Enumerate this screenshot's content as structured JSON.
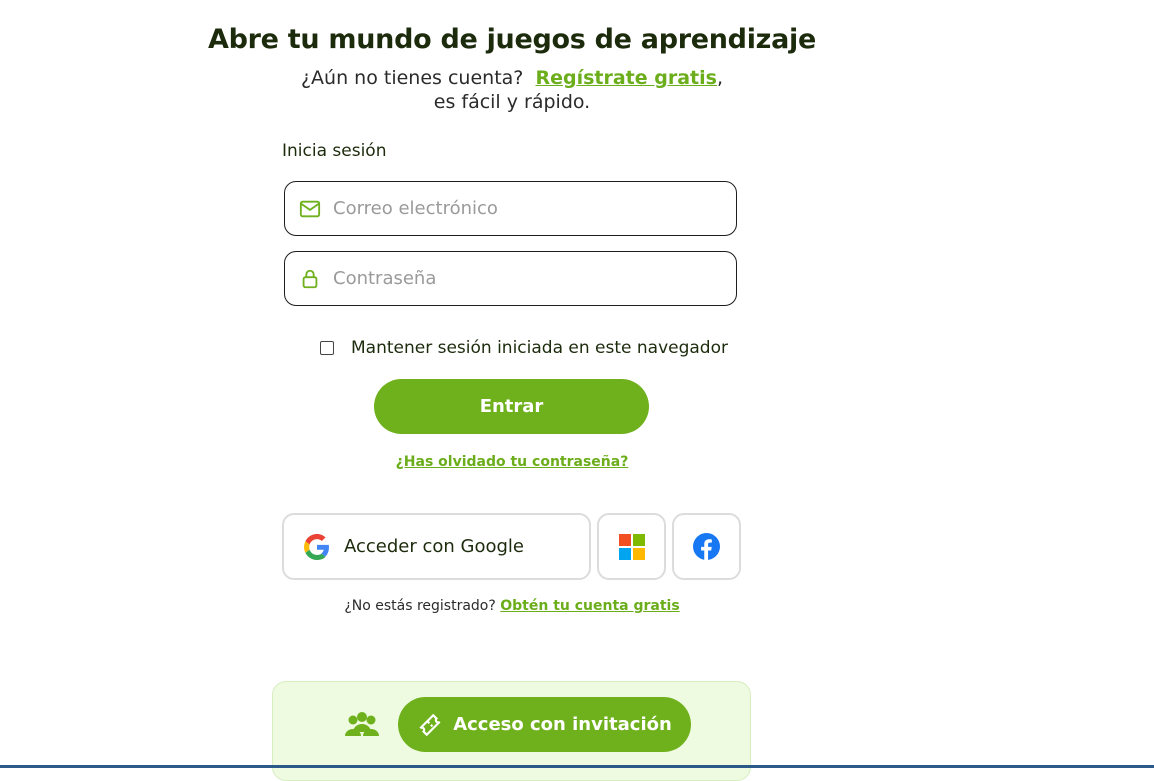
{
  "header": {
    "title": "Abre tu mundo de juegos de aprendizaje",
    "subtitle_prefix": "¿Aún no tienes cuenta?",
    "register_link": "Regístrate gratis",
    "subtitle_comma": ",",
    "subtitle_line2": "es fácil y rápido."
  },
  "login": {
    "label": "Inicia sesión",
    "email_placeholder": "Correo electrónico",
    "password_placeholder": "Contraseña",
    "remember_label": "Mantener sesión iniciada en este navegador",
    "submit_label": "Entrar",
    "forgot_link": "¿Has olvidado tu contraseña?"
  },
  "social": {
    "google_label": "Acceder con Google",
    "google_icon": "google-icon",
    "microsoft_icon": "microsoft-icon",
    "facebook_icon": "facebook-icon"
  },
  "register_prompt": {
    "text": "¿No estás registrado?",
    "link": "Obtén tu cuenta gratis"
  },
  "invitation": {
    "button_label": "Acceso con invitación",
    "group_icon": "group-icon",
    "ticket_icon": "ticket-icon"
  },
  "colors": {
    "accent": "#6fb11c",
    "panel_bg": "#eefbe0"
  }
}
